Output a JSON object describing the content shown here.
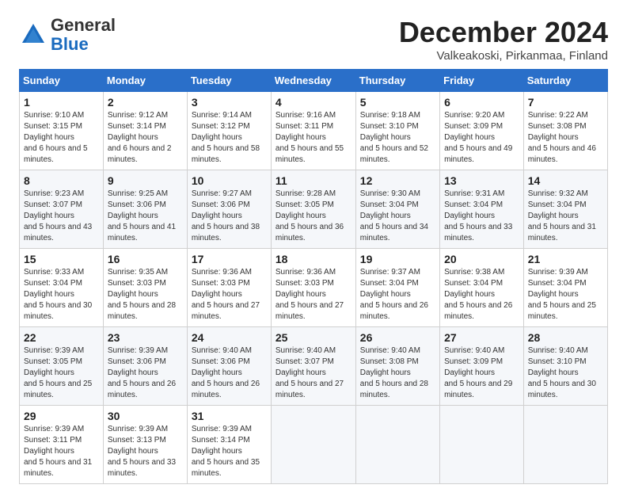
{
  "header": {
    "logo": {
      "general": "General",
      "blue": "Blue"
    },
    "title": "December 2024",
    "subtitle": "Valkeakoski, Pirkanmaa, Finland"
  },
  "calendar": {
    "days_of_week": [
      "Sunday",
      "Monday",
      "Tuesday",
      "Wednesday",
      "Thursday",
      "Friday",
      "Saturday"
    ],
    "weeks": [
      [
        {
          "day": "1",
          "sunrise": "9:10 AM",
          "sunset": "3:15 PM",
          "daylight": "6 hours and 5 minutes."
        },
        {
          "day": "2",
          "sunrise": "9:12 AM",
          "sunset": "3:14 PM",
          "daylight": "6 hours and 2 minutes."
        },
        {
          "day": "3",
          "sunrise": "9:14 AM",
          "sunset": "3:12 PM",
          "daylight": "5 hours and 58 minutes."
        },
        {
          "day": "4",
          "sunrise": "9:16 AM",
          "sunset": "3:11 PM",
          "daylight": "5 hours and 55 minutes."
        },
        {
          "day": "5",
          "sunrise": "9:18 AM",
          "sunset": "3:10 PM",
          "daylight": "5 hours and 52 minutes."
        },
        {
          "day": "6",
          "sunrise": "9:20 AM",
          "sunset": "3:09 PM",
          "daylight": "5 hours and 49 minutes."
        },
        {
          "day": "7",
          "sunrise": "9:22 AM",
          "sunset": "3:08 PM",
          "daylight": "5 hours and 46 minutes."
        }
      ],
      [
        {
          "day": "8",
          "sunrise": "9:23 AM",
          "sunset": "3:07 PM",
          "daylight": "5 hours and 43 minutes."
        },
        {
          "day": "9",
          "sunrise": "9:25 AM",
          "sunset": "3:06 PM",
          "daylight": "5 hours and 41 minutes."
        },
        {
          "day": "10",
          "sunrise": "9:27 AM",
          "sunset": "3:06 PM",
          "daylight": "5 hours and 38 minutes."
        },
        {
          "day": "11",
          "sunrise": "9:28 AM",
          "sunset": "3:05 PM",
          "daylight": "5 hours and 36 minutes."
        },
        {
          "day": "12",
          "sunrise": "9:30 AM",
          "sunset": "3:04 PM",
          "daylight": "5 hours and 34 minutes."
        },
        {
          "day": "13",
          "sunrise": "9:31 AM",
          "sunset": "3:04 PM",
          "daylight": "5 hours and 33 minutes."
        },
        {
          "day": "14",
          "sunrise": "9:32 AM",
          "sunset": "3:04 PM",
          "daylight": "5 hours and 31 minutes."
        }
      ],
      [
        {
          "day": "15",
          "sunrise": "9:33 AM",
          "sunset": "3:04 PM",
          "daylight": "5 hours and 30 minutes."
        },
        {
          "day": "16",
          "sunrise": "9:35 AM",
          "sunset": "3:03 PM",
          "daylight": "5 hours and 28 minutes."
        },
        {
          "day": "17",
          "sunrise": "9:36 AM",
          "sunset": "3:03 PM",
          "daylight": "5 hours and 27 minutes."
        },
        {
          "day": "18",
          "sunrise": "9:36 AM",
          "sunset": "3:03 PM",
          "daylight": "5 hours and 27 minutes."
        },
        {
          "day": "19",
          "sunrise": "9:37 AM",
          "sunset": "3:04 PM",
          "daylight": "5 hours and 26 minutes."
        },
        {
          "day": "20",
          "sunrise": "9:38 AM",
          "sunset": "3:04 PM",
          "daylight": "5 hours and 26 minutes."
        },
        {
          "day": "21",
          "sunrise": "9:39 AM",
          "sunset": "3:04 PM",
          "daylight": "5 hours and 25 minutes."
        }
      ],
      [
        {
          "day": "22",
          "sunrise": "9:39 AM",
          "sunset": "3:05 PM",
          "daylight": "5 hours and 25 minutes."
        },
        {
          "day": "23",
          "sunrise": "9:39 AM",
          "sunset": "3:06 PM",
          "daylight": "5 hours and 26 minutes."
        },
        {
          "day": "24",
          "sunrise": "9:40 AM",
          "sunset": "3:06 PM",
          "daylight": "5 hours and 26 minutes."
        },
        {
          "day": "25",
          "sunrise": "9:40 AM",
          "sunset": "3:07 PM",
          "daylight": "5 hours and 27 minutes."
        },
        {
          "day": "26",
          "sunrise": "9:40 AM",
          "sunset": "3:08 PM",
          "daylight": "5 hours and 28 minutes."
        },
        {
          "day": "27",
          "sunrise": "9:40 AM",
          "sunset": "3:09 PM",
          "daylight": "5 hours and 29 minutes."
        },
        {
          "day": "28",
          "sunrise": "9:40 AM",
          "sunset": "3:10 PM",
          "daylight": "5 hours and 30 minutes."
        }
      ],
      [
        {
          "day": "29",
          "sunrise": "9:39 AM",
          "sunset": "3:11 PM",
          "daylight": "5 hours and 31 minutes."
        },
        {
          "day": "30",
          "sunrise": "9:39 AM",
          "sunset": "3:13 PM",
          "daylight": "5 hours and 33 minutes."
        },
        {
          "day": "31",
          "sunrise": "9:39 AM",
          "sunset": "3:14 PM",
          "daylight": "5 hours and 35 minutes."
        },
        null,
        null,
        null,
        null
      ]
    ]
  }
}
